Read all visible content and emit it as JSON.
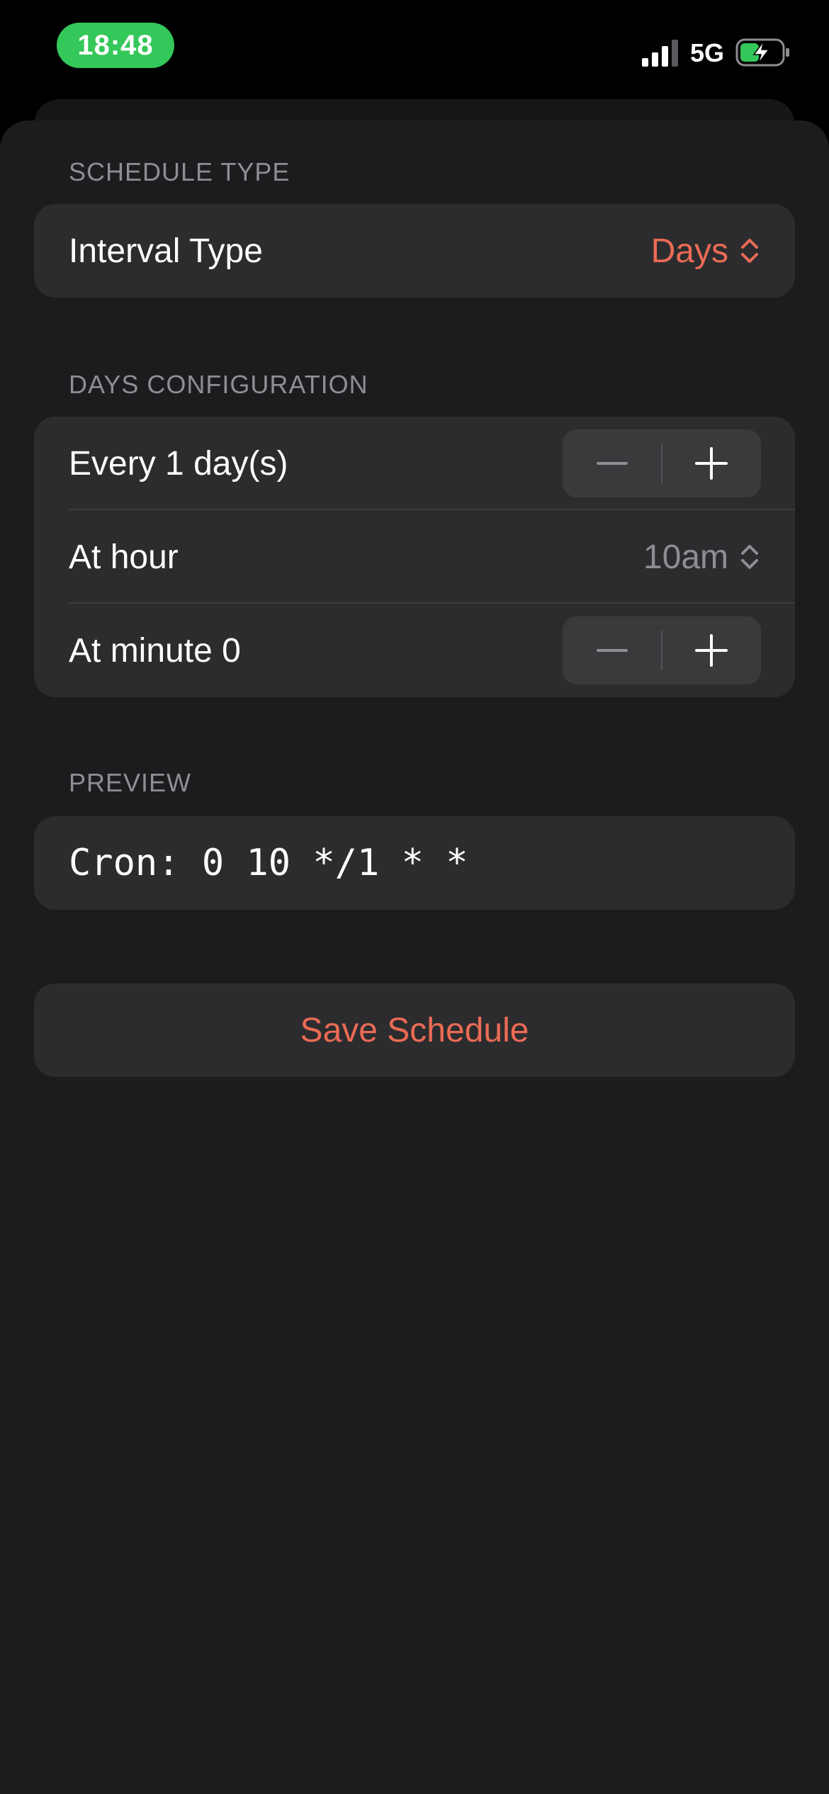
{
  "status_bar": {
    "time": "18:48",
    "network": "5G",
    "icons": [
      "signal-icon",
      "battery-charging-icon"
    ]
  },
  "schedule_type": {
    "header": "SCHEDULE TYPE",
    "interval_type_label": "Interval Type",
    "interval_type_value": "Days"
  },
  "days_configuration": {
    "header": "DAYS CONFIGURATION",
    "every_label": "Every 1 day(s)",
    "hour_label": "At hour",
    "hour_value": "10am",
    "minute_label": "At minute 0"
  },
  "preview": {
    "header": "PREVIEW",
    "cron_text": "Cron: 0 10 */1 * *"
  },
  "actions": {
    "save_label": "Save Schedule"
  },
  "colors": {
    "accent": "#eb6b55",
    "background": "#1c1c1e",
    "group_background": "#2c2c2e",
    "secondary_text": "#8e8e93",
    "time_pill": "#34c759"
  }
}
